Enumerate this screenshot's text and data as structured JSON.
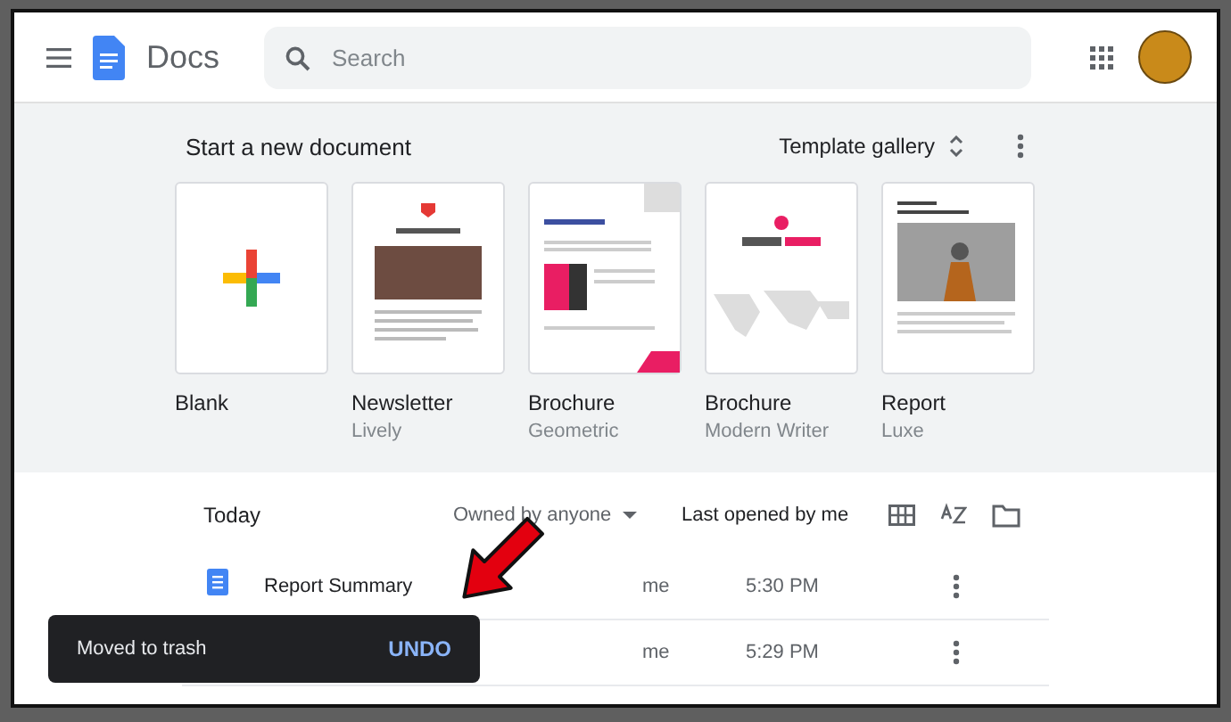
{
  "app": {
    "title": "Docs"
  },
  "search": {
    "placeholder": "Search"
  },
  "new_document": {
    "heading": "Start a new document",
    "gallery_label": "Template gallery",
    "templates": [
      {
        "kind": "blank",
        "name": "Blank"
      },
      {
        "kind": "newsletter",
        "name": "Newsletter",
        "subtitle": "Lively"
      },
      {
        "kind": "brochure",
        "name": "Brochure",
        "subtitle": "Geometric"
      },
      {
        "kind": "travel",
        "name": "Brochure",
        "subtitle": "Modern Writer"
      },
      {
        "kind": "report",
        "name": "Report",
        "subtitle": "Luxe"
      }
    ]
  },
  "documents": {
    "heading": "Today",
    "owner_filter": "Owned by anyone",
    "sort_label": "Last opened by me",
    "rows": [
      {
        "name": "Report Summary",
        "owner": "me",
        "time": "5:30 PM"
      },
      {
        "owner": "me",
        "time": "5:29 PM"
      }
    ]
  },
  "snackbar": {
    "message": "Moved to trash",
    "action": "UNDO"
  }
}
